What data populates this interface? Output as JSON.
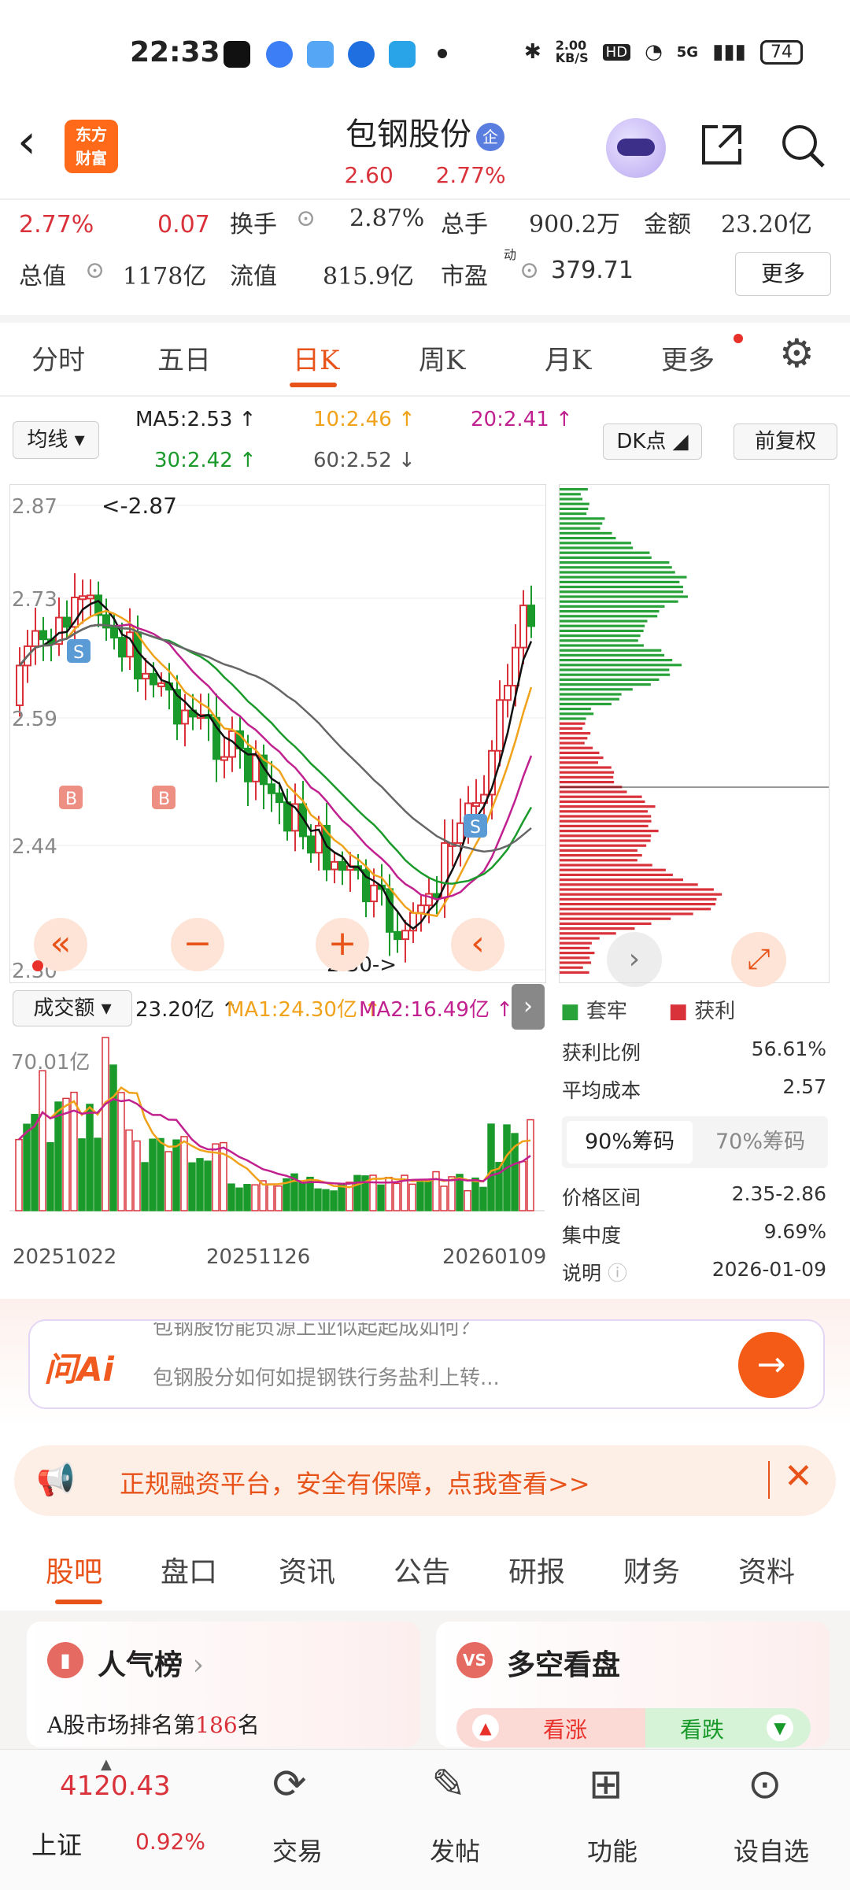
{
  "status_bar": {
    "time": "22:33",
    "net_speed": "2.00\nKB/S",
    "hd": "HD",
    "net": "5G",
    "battery": "74"
  },
  "header": {
    "logo_line1": "东方",
    "logo_line2": "财富",
    "stock_name": "包钢股份",
    "badge": "企",
    "price": "2.60",
    "change_pct": "2.77%"
  },
  "quote": {
    "row1": {
      "pct": "2.77%",
      "chg": "0.07",
      "turnover_label": "换手",
      "turnover": "2.87%",
      "volume_label": "总手",
      "volume": "900.2万",
      "amount_label": "金额",
      "amount": "23.20亿"
    },
    "row2": {
      "mcap_label": "总值",
      "mcap": "1178亿",
      "float_label": "流值",
      "float": "815.9亿",
      "pe_label": "市盈",
      "pe_sup": "动",
      "pe": "379.71",
      "more": "更多"
    }
  },
  "tabs": [
    "分时",
    "五日",
    "日K",
    "周K",
    "月K",
    "更多"
  ],
  "ma": {
    "selector": "均线",
    "ma5": "MA5:2.53",
    "ma10": "10:2.46",
    "ma20": "20:2.41",
    "ma30": "30:2.42",
    "ma60": "60:2.52",
    "dk": "DK点",
    "adjust": "前复权"
  },
  "chart_data": {
    "type": "candlestick",
    "y_ticks": [
      "2.87",
      "2.73",
      "2.59",
      "2.44",
      "2.30"
    ],
    "high_label": "<-2.87",
    "low_label": "2.30->",
    "signals": [
      "S",
      "B",
      "B",
      "S"
    ],
    "x_ticks": [
      "20251022",
      "20251126",
      "20260109"
    ],
    "volume_max_label": "70.01亿"
  },
  "volume_bar": {
    "selector": "成交额",
    "val": "23.20亿",
    "ma1": "MA1:24.30亿",
    "ma2": "MA2:16.49亿"
  },
  "chips": {
    "legend_trapped": "套牢",
    "legend_profit": "获利",
    "stats": [
      {
        "label": "获利比例",
        "value": "56.61%"
      },
      {
        "label": "平均成本",
        "value": "2.57"
      }
    ],
    "tab_90": "90%筹码",
    "tab_70": "70%筹码",
    "stats2": [
      {
        "label": "价格区间",
        "value": "2.35-2.86"
      },
      {
        "label": "集中度",
        "value": "9.69%"
      },
      {
        "label": "说明",
        "value": "2026-01-09"
      }
    ]
  },
  "ai": {
    "label": "问Ai",
    "line1": "包钢股份能负源上业似起起成如何？",
    "line2": "包钢股分如何如提钢铁行务盐利上转..."
  },
  "promo": {
    "text": "正规融资平台，安全有保障，点我查看>>"
  },
  "bottom_tabs": [
    "股吧",
    "盘口",
    "资讯",
    "公告",
    "研报",
    "财务",
    "资料"
  ],
  "cards": {
    "left_title": "人气榜",
    "left_sub_prefix": "A股市场排名第",
    "left_rank": "186",
    "left_sub_suffix": "名",
    "right_title": "多空看盘",
    "up": "看涨",
    "down": "看跌"
  },
  "bottom_nav": {
    "index_value": "4120.43",
    "index_name": "上证",
    "index_pct": "0.92%",
    "items": [
      "交易",
      "发帖",
      "功能",
      "设自选"
    ]
  }
}
